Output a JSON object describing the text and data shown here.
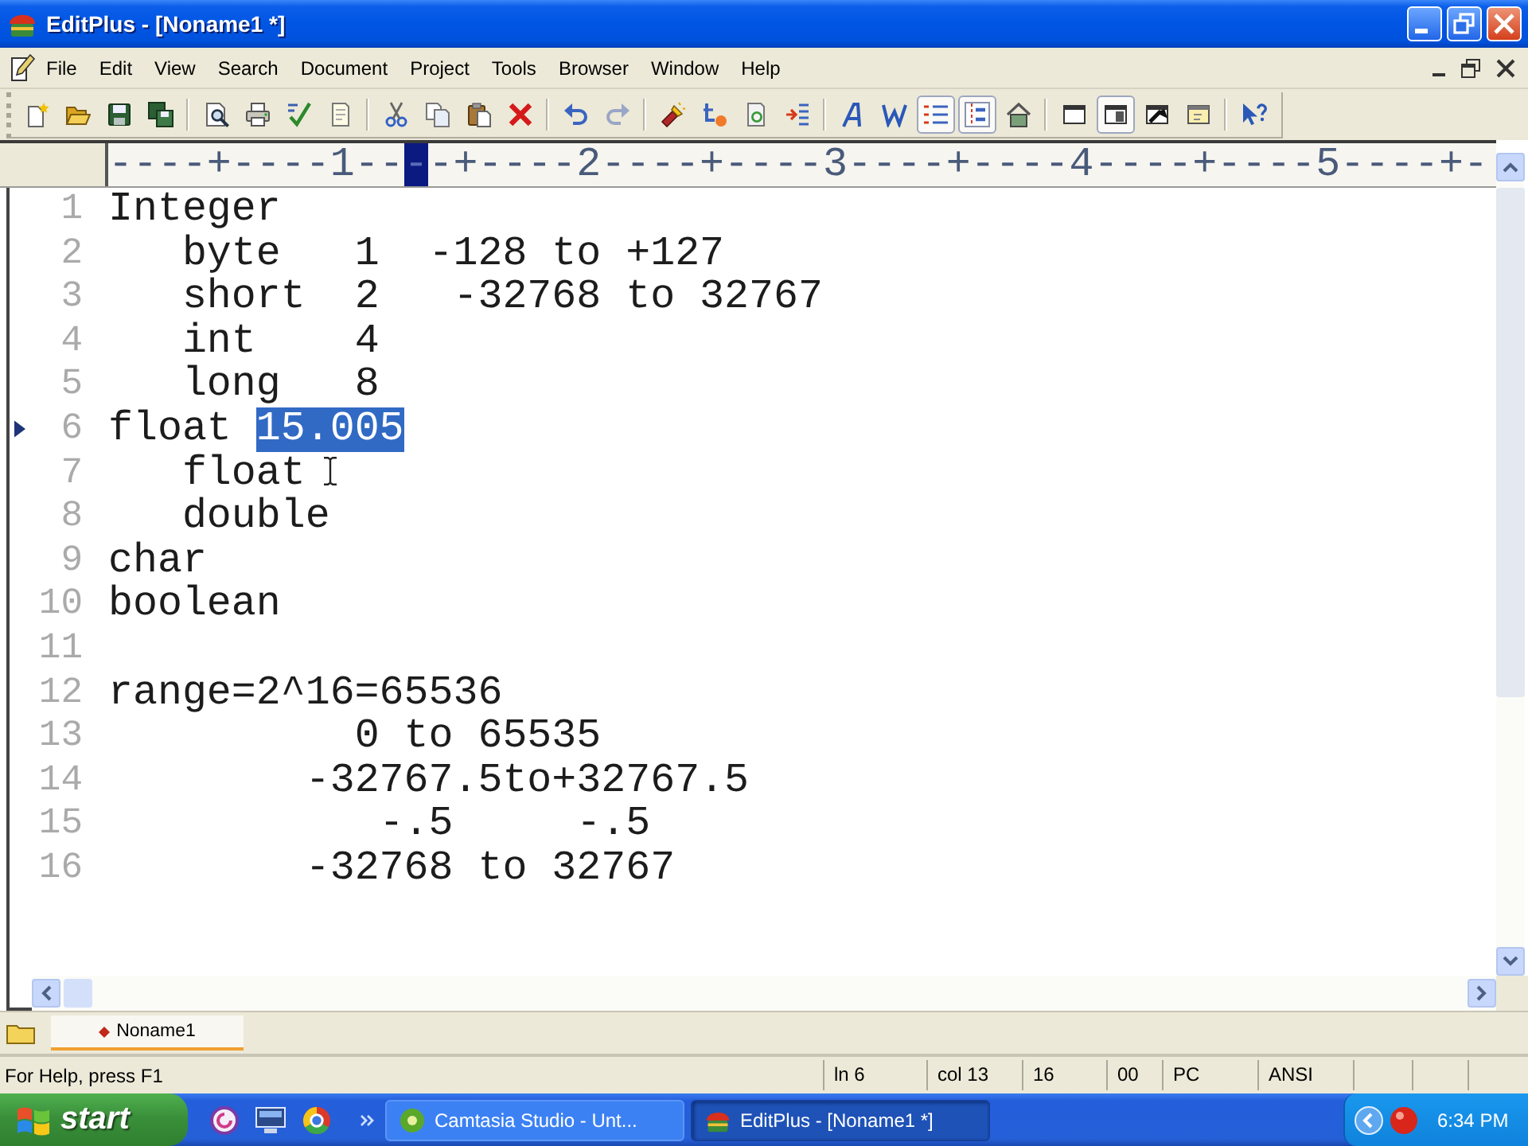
{
  "window": {
    "title": "EditPlus - [Noname1 *]"
  },
  "menu_bar": {
    "items": [
      "File",
      "Edit",
      "View",
      "Search",
      "Document",
      "Project",
      "Tools",
      "Browser",
      "Window",
      "Help"
    ]
  },
  "toolbar": [
    {
      "kind": "button",
      "pressed": false
    },
    {
      "kind": "button",
      "pressed": false
    },
    {
      "kind": "button",
      "pressed": false
    },
    {
      "kind": "button",
      "pressed": false
    },
    {
      "kind": "separator"
    },
    {
      "kind": "button",
      "pressed": false
    },
    {
      "kind": "button",
      "pressed": false
    },
    {
      "kind": "button",
      "pressed": false
    },
    {
      "kind": "button",
      "pressed": false
    },
    {
      "kind": "separator"
    },
    {
      "kind": "button",
      "pressed": false
    },
    {
      "kind": "button",
      "pressed": false
    },
    {
      "kind": "button",
      "pressed": false
    },
    {
      "kind": "button",
      "pressed": false
    },
    {
      "kind": "separator"
    },
    {
      "kind": "button",
      "pressed": false
    },
    {
      "kind": "button",
      "pressed": false
    },
    {
      "kind": "separator"
    },
    {
      "kind": "button",
      "pressed": false
    },
    {
      "kind": "button",
      "pressed": false
    },
    {
      "kind": "button",
      "pressed": false
    },
    {
      "kind": "button",
      "pressed": false
    },
    {
      "kind": "separator"
    },
    {
      "kind": "button",
      "pressed": false
    },
    {
      "kind": "button",
      "pressed": false
    },
    {
      "kind": "button",
      "pressed": true
    },
    {
      "kind": "button",
      "pressed": true
    },
    {
      "kind": "button",
      "pressed": false
    },
    {
      "kind": "separator"
    },
    {
      "kind": "button",
      "pressed": false
    },
    {
      "kind": "button",
      "pressed": true
    },
    {
      "kind": "button",
      "pressed": false
    },
    {
      "kind": "button",
      "pressed": false
    },
    {
      "kind": "separator"
    },
    {
      "kind": "button",
      "pressed": false
    }
  ],
  "ruler": [
    {
      "text": "----+----1--",
      "marked": false
    },
    {
      "text": "-",
      "marked": true
    },
    {
      "text": "-+----2----+----3----+----4----+----5----+-",
      "marked": false
    }
  ],
  "editor": {
    "lines": [
      {
        "number": "1",
        "text": "Integer",
        "current": false
      },
      {
        "number": "2",
        "text": "   byte   1  -128 to +127",
        "current": false
      },
      {
        "number": "3",
        "text": "   short  2   -32768 to 32767",
        "current": false
      },
      {
        "number": "4",
        "text": "   int    4",
        "current": false
      },
      {
        "number": "5",
        "text": "   long   8",
        "current": false
      },
      {
        "number": "6",
        "text": "float ",
        "selection": "15.005",
        "current": true
      },
      {
        "number": "7",
        "text": "   float",
        "current": false
      },
      {
        "number": "8",
        "text": "   double",
        "current": false
      },
      {
        "number": "9",
        "text": "char",
        "current": false
      },
      {
        "number": "10",
        "text": "boolean",
        "current": false
      },
      {
        "number": "11",
        "current": false
      },
      {
        "number": "12",
        "text": "range=2^16=65536",
        "current": false
      },
      {
        "number": "13",
        "text": "          0 to 65535",
        "current": false
      },
      {
        "number": "14",
        "text": "        -32767.5to+32767.5",
        "current": false
      },
      {
        "number": "15",
        "text": "           -.5     -.5",
        "current": false
      },
      {
        "number": "16",
        "text": "        -32768 to 32767",
        "current": false
      }
    ]
  },
  "document_tabs": [
    {
      "label": "Noname1",
      "selected": true,
      "modified": true
    }
  ],
  "status_bar": {
    "message": "For Help, press F1",
    "panels": [
      "ln 6",
      "col 13",
      "16",
      "00",
      "PC",
      "ANSI"
    ]
  },
  "taskbar": {
    "start_label": "start",
    "tasks": [
      {
        "label": "Camtasia Studio - Unt...",
        "selected": false
      },
      {
        "label": "EditPlus - [Noname1 *]",
        "selected": true
      }
    ],
    "clock": "6:34 PM"
  }
}
